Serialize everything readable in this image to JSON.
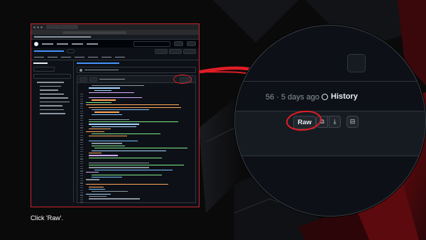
{
  "caption": "Click 'Raw'.",
  "zoom": {
    "meta_fragment": "56 · 5 days ago",
    "history_label": "History",
    "raw_label": "Raw",
    "icons": [
      "copy-icon",
      "download-icon",
      "symbols-icon"
    ]
  },
  "colors": {
    "highlight": "#e11d25",
    "frame": "#c8262a",
    "panel": "#0d1117",
    "border": "#30363d"
  }
}
